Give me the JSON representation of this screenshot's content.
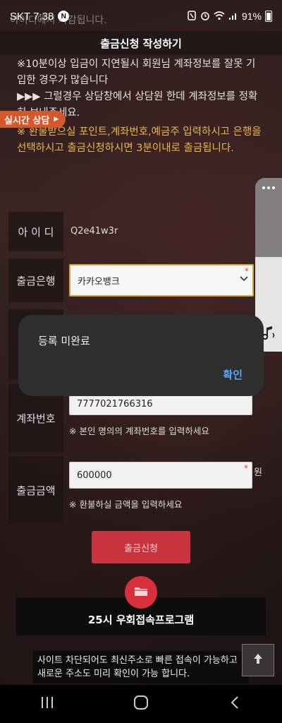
{
  "status_bar": {
    "time_label": "SKT 7:38",
    "notif_badge": "N",
    "battery_text": "91%"
  },
  "header": {
    "title": "출금신청 작성하기"
  },
  "intro_text": "아이디에서 차감됩니다.",
  "notice": {
    "line1": "※10분이상 입금이 지연될시 회원님 계좌정보를 잘못 기입한 경우가 많습니다",
    "line2": "▶▶▶ 그럴경우 상담창에서 상담원 한데 계좌정보를 정확히 보내주세요.",
    "warning": "※ 환불받으실 포인트,계좌번호,예금주 입력하시고 은행을 선택하시고 출금신청하시면 3분이내로 출금됩니다."
  },
  "live_chat": {
    "label": "실시간 상담",
    "arrow": "▶"
  },
  "form": {
    "id": {
      "label": "아 이 디",
      "value": "Q2e41w3r"
    },
    "bank": {
      "label": "출금은행",
      "value": "카카오뱅크",
      "required_mark": "*"
    },
    "account": {
      "label": "계좌번호",
      "value": "7777021766316",
      "hint": "※ 본인 명의의 계좌번호를 입력하세요"
    },
    "amount": {
      "label": "출금금액",
      "value": "600000",
      "required_mark": "*",
      "unit": "원",
      "hint": "※ 환불하실 금액을 입력하세요"
    }
  },
  "submit_label": "출금신청",
  "program": {
    "title": "25시 우회접속프로그램",
    "description": "사이트 차단되어도 최신주소로 빠른 접속이 가능하고 새로운 주소도 미리 확인이 가능 합니다."
  },
  "dialog": {
    "message": "등록 미완료",
    "confirm_label": "확인"
  },
  "colors": {
    "accent_red": "#c9343e",
    "warning_yellow": "#e7b84a",
    "dialog_button": "#58a8ff",
    "live_chat_orange": "#d4582a"
  },
  "icons": [
    "nfc-icon",
    "alarm-icon",
    "wifi-icon",
    "signal-icon",
    "battery-icon",
    "folder-icon",
    "arrow-up-icon",
    "more-dots-icon",
    "music-note-icon",
    "recent-apps-icon",
    "home-icon",
    "back-icon"
  ]
}
